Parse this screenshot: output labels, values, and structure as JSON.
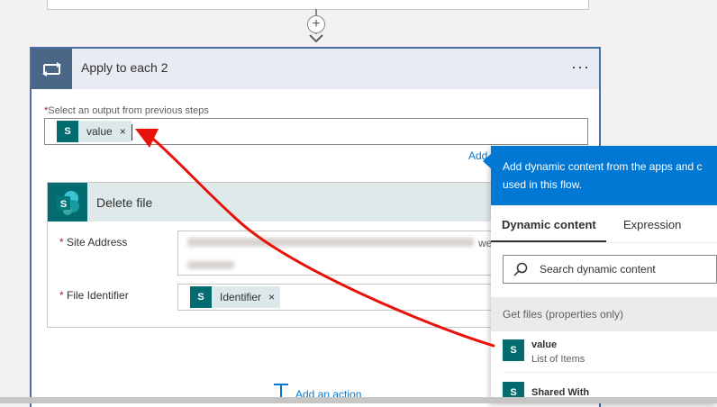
{
  "apply_each": {
    "title": "Apply to each 2",
    "more_label": "···",
    "output_label": "Select an output from previous steps",
    "output_token": "value",
    "token_remove": "×",
    "add_dynamic_link": "Add"
  },
  "delete_file": {
    "title": "Delete file",
    "site_label": "Site Address",
    "site_value_tail": "we",
    "file_id_label": "File Identifier",
    "file_id_token": "Identifier",
    "token_remove": "×"
  },
  "add_action_label": "Add an action",
  "dynamic_panel": {
    "description_line1": "Add dynamic content from the apps and c",
    "description_line2": "used in this flow.",
    "tabs": [
      "Dynamic content",
      "Expression"
    ],
    "active_tab": "Dynamic content",
    "search_placeholder": "Search dynamic content",
    "section_header": "Get files (properties only)",
    "items": [
      {
        "title": "value",
        "subtitle": "List of Items"
      },
      {
        "title": "Shared With",
        "subtitle": ""
      }
    ]
  },
  "colors": {
    "accent": "#0078d4",
    "sharepoint": "#036c70",
    "apply_border": "#4a6fa5",
    "annotation_arrow": "#e8110b",
    "required": "#a4262c"
  },
  "icons": [
    "loop-icon",
    "sharepoint-icon",
    "search-icon",
    "plus-icon",
    "add-action-icon"
  ]
}
